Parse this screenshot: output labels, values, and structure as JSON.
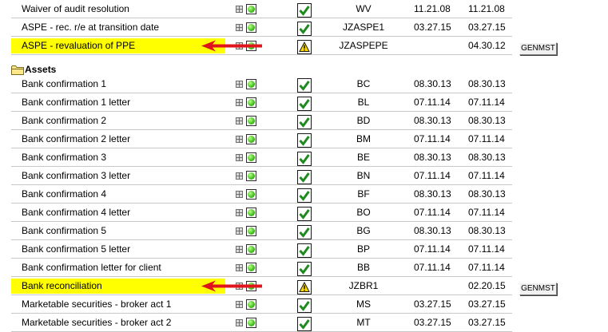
{
  "colors": {
    "highlight": "#ffff00",
    "arrow": "#e0141b",
    "check_green": "#1f8a1f",
    "warning_yellow": "#ffd700"
  },
  "sections_before": [
    {
      "description": "Waiver of audit resolution",
      "code": "WV",
      "date1": "11.21.08",
      "date2": "11.21.08",
      "status": "check",
      "highlight": false,
      "arrow": false,
      "button": null
    },
    {
      "description": "ASPE - rec. r/e at transition date",
      "code": "JZASPE1",
      "date1": "03.27.15",
      "date2": "03.27.15",
      "status": "check",
      "highlight": false,
      "arrow": false,
      "button": null
    },
    {
      "description": "ASPE - revaluation of PPE",
      "code": "JZASPEPE",
      "date1": "",
      "date2": "04.30.12",
      "status": "warning",
      "highlight": true,
      "arrow": true,
      "button": "GENMST"
    }
  ],
  "section_header": {
    "label": "Assets",
    "icon": "folder-icon"
  },
  "assets": [
    {
      "description": "Bank confirmation 1",
      "code": "BC",
      "date1": "08.30.13",
      "date2": "08.30.13",
      "status": "check",
      "highlight": false,
      "arrow": false,
      "button": null
    },
    {
      "description": "Bank confirmation 1 letter",
      "code": "BL",
      "date1": "07.11.14",
      "date2": "07.11.14",
      "status": "check",
      "highlight": false,
      "arrow": false,
      "button": null
    },
    {
      "description": "Bank confirmation 2",
      "code": "BD",
      "date1": "08.30.13",
      "date2": "08.30.13",
      "status": "check",
      "highlight": false,
      "arrow": false,
      "button": null
    },
    {
      "description": "Bank confirmation 2 letter",
      "code": "BM",
      "date1": "07.11.14",
      "date2": "07.11.14",
      "status": "check",
      "highlight": false,
      "arrow": false,
      "button": null
    },
    {
      "description": "Bank confirmation 3",
      "code": "BE",
      "date1": "08.30.13",
      "date2": "08.30.13",
      "status": "check",
      "highlight": false,
      "arrow": false,
      "button": null
    },
    {
      "description": "Bank confirmation 3 letter",
      "code": "BN",
      "date1": "07.11.14",
      "date2": "07.11.14",
      "status": "check",
      "highlight": false,
      "arrow": false,
      "button": null
    },
    {
      "description": "Bank confirmation 4",
      "code": "BF",
      "date1": "08.30.13",
      "date2": "08.30.13",
      "status": "check",
      "highlight": false,
      "arrow": false,
      "button": null
    },
    {
      "description": "Bank confirmation 4 letter",
      "code": "BO",
      "date1": "07.11.14",
      "date2": "07.11.14",
      "status": "check",
      "highlight": false,
      "arrow": false,
      "button": null
    },
    {
      "description": "Bank confirmation 5",
      "code": "BG",
      "date1": "08.30.13",
      "date2": "08.30.13",
      "status": "check",
      "highlight": false,
      "arrow": false,
      "button": null
    },
    {
      "description": "Bank confirmation 5 letter",
      "code": "BP",
      "date1": "07.11.14",
      "date2": "07.11.14",
      "status": "check",
      "highlight": false,
      "arrow": false,
      "button": null
    },
    {
      "description": "Bank confirmation letter for client",
      "code": "BB",
      "date1": "07.11.14",
      "date2": "07.11.14",
      "status": "check",
      "highlight": false,
      "arrow": false,
      "button": null
    },
    {
      "description": "Bank reconciliation",
      "code": "JZBR1",
      "date1": "",
      "date2": "02.20.15",
      "status": "warning",
      "highlight": true,
      "arrow": true,
      "button": "GENMST"
    },
    {
      "description": "Marketable securities - broker act 1",
      "code": "MS",
      "date1": "03.27.15",
      "date2": "03.27.15",
      "status": "check",
      "highlight": false,
      "arrow": false,
      "button": null
    },
    {
      "description": "Marketable securities - broker act 2",
      "code": "MT",
      "date1": "03.27.15",
      "date2": "03.27.15",
      "status": "check",
      "highlight": false,
      "arrow": false,
      "button": null
    }
  ]
}
